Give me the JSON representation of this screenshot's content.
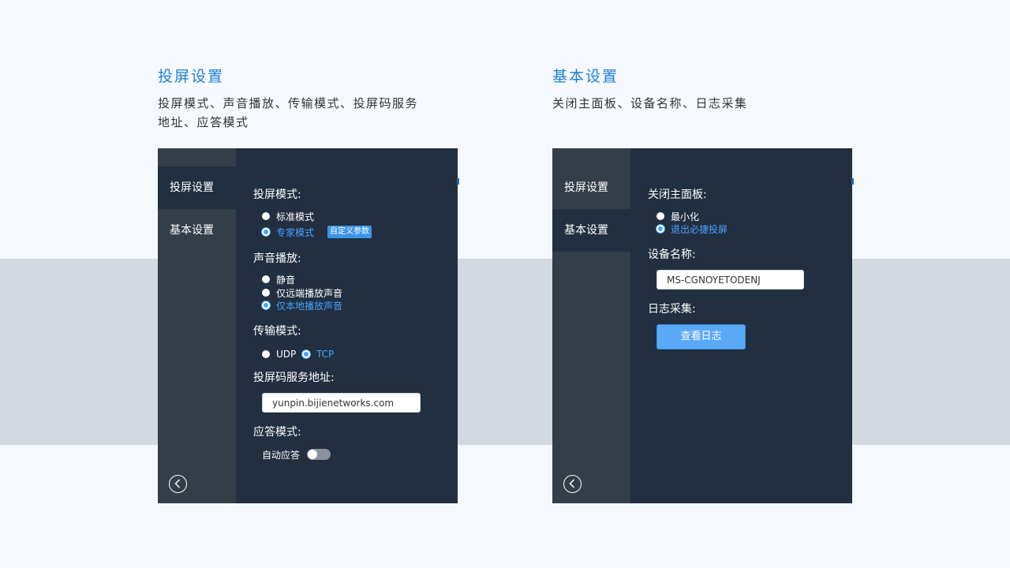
{
  "left_intro": {
    "title": "投屏设置",
    "desc_line1": "投屏模式、声音播放、传输模式、投屏码服务",
    "desc_line2": "地址、应答模式"
  },
  "right_intro": {
    "title": "基本设置",
    "desc": "关闭主面板、设备名称、日志采集"
  },
  "sidebar": {
    "items": [
      {
        "label": "投屏设置"
      },
      {
        "label": "基本设置"
      }
    ],
    "back_icon": "chevron-left-circle-icon"
  },
  "screen_settings": {
    "mode": {
      "label": "投屏模式:",
      "options": [
        "标准模式",
        "专家模式"
      ],
      "selected": "专家模式",
      "custom_params_label": "自定义参数"
    },
    "sound": {
      "label": "声音播放:",
      "options": [
        "静音",
        "仅远端播放声音",
        "仅本地播放声音"
      ],
      "selected": "仅本地播放声音"
    },
    "transport": {
      "label": "传输模式:",
      "options": [
        "UDP",
        "TCP"
      ],
      "selected": "TCP"
    },
    "server_address": {
      "label": "投屏码服务地址:",
      "value": "yunpin.bijienetworks.com"
    },
    "answer_mode": {
      "label": "应答模式:",
      "toggle_label": "自动应答",
      "enabled": false
    }
  },
  "basic_settings": {
    "close_panel": {
      "label": "关闭主面板:",
      "options": [
        "最小化",
        "退出必捷投屏"
      ],
      "selected": "退出必捷投屏"
    },
    "device_name": {
      "label": "设备名称:",
      "value": "MS-CGNOYETODENJ"
    },
    "log": {
      "label": "日志采集:",
      "button_label": "查看日志"
    }
  },
  "colors": {
    "accent": "#4aa3ff",
    "title_blue": "#1f7fd6",
    "panel_bg": "#212f40",
    "sidebar_bg": "#343e49"
  }
}
